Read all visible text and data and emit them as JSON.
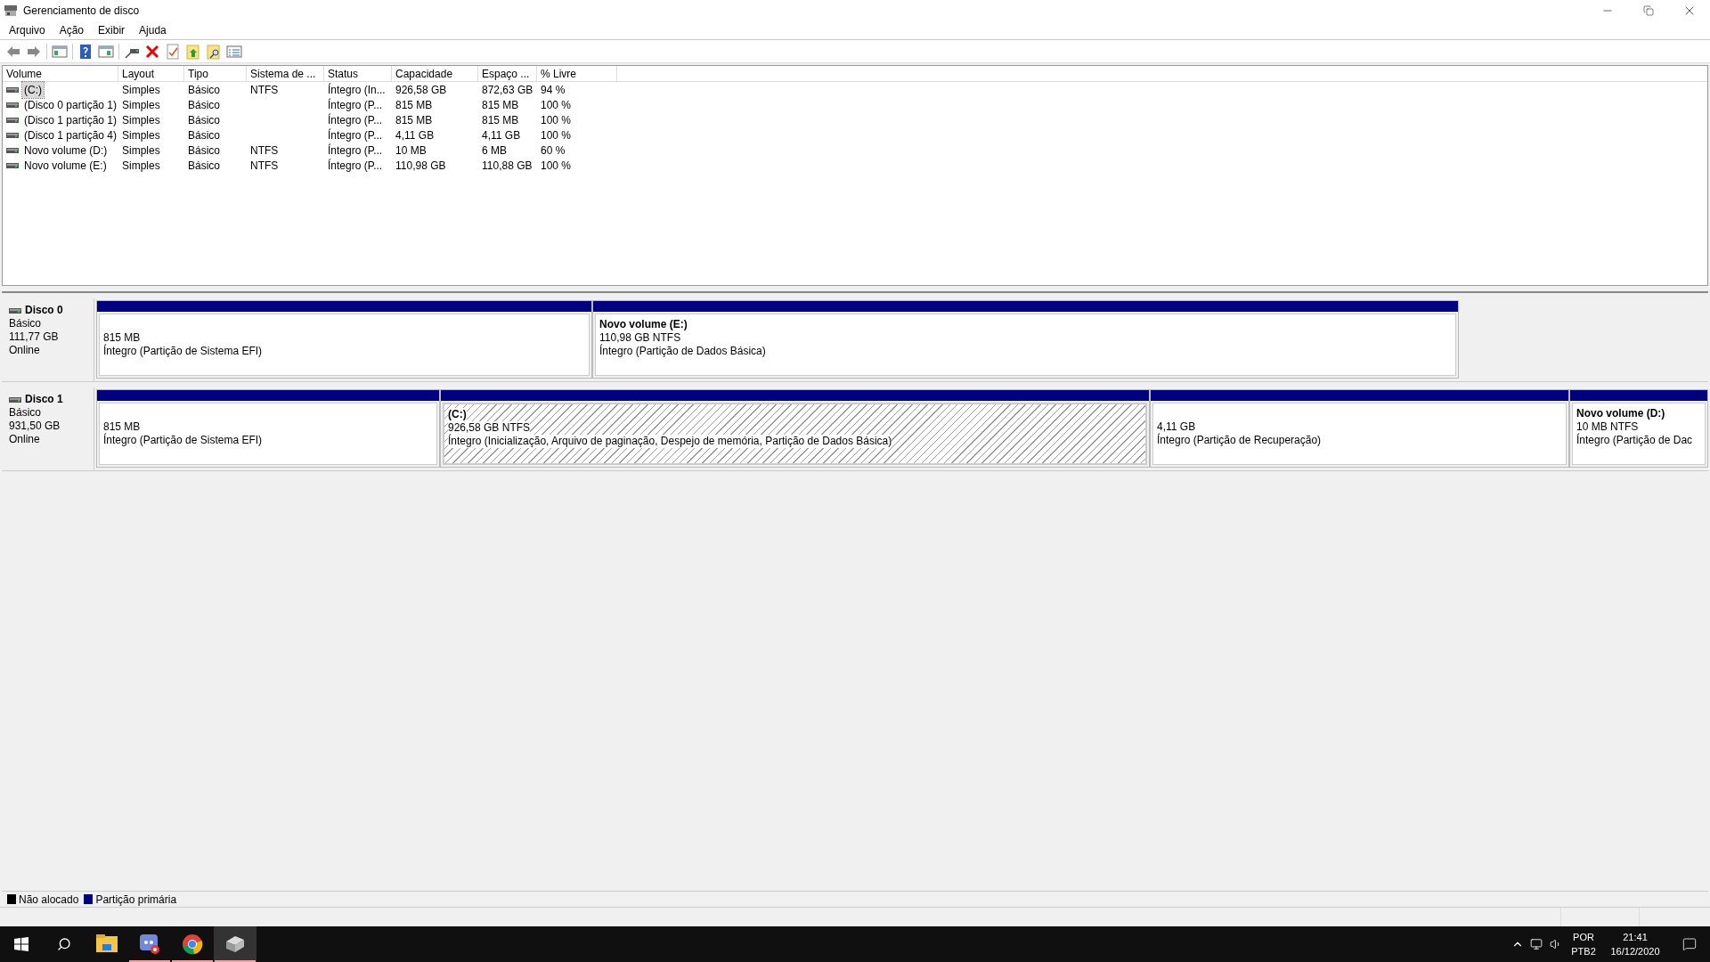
{
  "window": {
    "title": "Gerenciamento de disco"
  },
  "menu": [
    "Arquivo",
    "Ação",
    "Exibir",
    "Ajuda"
  ],
  "table": {
    "columns": [
      "Volume",
      "Layout",
      "Tipo",
      "Sistema de ...",
      "Status",
      "Capacidade",
      "Espaço ...",
      "% Livre"
    ],
    "rows": [
      {
        "selected": true,
        "cells": [
          "(C:)",
          "Simples",
          "Básico",
          "NTFS",
          "Íntegro (In...",
          "926,58 GB",
          "872,63 GB",
          "94 %"
        ]
      },
      {
        "selected": false,
        "cells": [
          "(Disco 0 partição 1)",
          "Simples",
          "Básico",
          "",
          "Íntegro (P...",
          "815 MB",
          "815 MB",
          "100 %"
        ]
      },
      {
        "selected": false,
        "cells": [
          "(Disco 1 partição 1)",
          "Simples",
          "Básico",
          "",
          "Íntegro (P...",
          "815 MB",
          "815 MB",
          "100 %"
        ]
      },
      {
        "selected": false,
        "cells": [
          "(Disco 1 partição 4)",
          "Simples",
          "Básico",
          "",
          "Íntegro (P...",
          "4,11 GB",
          "4,11 GB",
          "100 %"
        ]
      },
      {
        "selected": false,
        "cells": [
          "Novo volume (D:)",
          "Simples",
          "Básico",
          "NTFS",
          "Íntegro (P...",
          "10 MB",
          "6 MB",
          "60 %"
        ]
      },
      {
        "selected": false,
        "cells": [
          "Novo volume (E:)",
          "Simples",
          "Básico",
          "NTFS",
          "Íntegro (P...",
          "110,98 GB",
          "110,88 GB",
          "100 %"
        ]
      }
    ]
  },
  "disks": [
    {
      "name": "Disco 0",
      "type": "Básico",
      "size": "111,77 GB",
      "state": "Online",
      "partitions": [
        {
          "selected": false,
          "size": "815 MB",
          "status": "Íntegro (Partição de Sistema EFI)"
        },
        {
          "selected": false,
          "name": "Novo volume  (E:)",
          "size": "110,98 GB NTFS",
          "status": "Íntegro (Partição de Dados Básica)"
        }
      ]
    },
    {
      "name": "Disco 1",
      "type": "Básico",
      "size": "931,50 GB",
      "state": "Online",
      "partitions": [
        {
          "selected": false,
          "size": "815 MB",
          "status": "Íntegro (Partição de Sistema EFI)"
        },
        {
          "selected": true,
          "name": "(C:)",
          "size": "926,58 GB NTFS",
          "status": "Íntegro (Inicialização, Arquivo de paginação, Despejo de memória, Partição de Dados Básica)"
        },
        {
          "selected": false,
          "size": "4,11 GB",
          "status": "Íntegro (Partição de Recuperação)"
        },
        {
          "selected": false,
          "name": "Novo volume  (D:)",
          "size": "10 MB NTFS",
          "status": "Íntegro (Partição de Dac"
        }
      ]
    }
  ],
  "legend": [
    {
      "label": "Não alocado",
      "color": "#000000"
    },
    {
      "label": "Partição primária",
      "color": "#000080"
    }
  ],
  "taskbar": {
    "apps": [
      {
        "kind": "folder",
        "running": false,
        "selected": false
      },
      {
        "kind": "chat",
        "running": true,
        "selected": false
      },
      {
        "kind": "browser",
        "running": true,
        "selected": false
      },
      {
        "kind": "disk",
        "running": true,
        "selected": true
      }
    ],
    "language": [
      "POR",
      "PTB2"
    ],
    "time": "21:41",
    "date": "16/12/2020"
  }
}
